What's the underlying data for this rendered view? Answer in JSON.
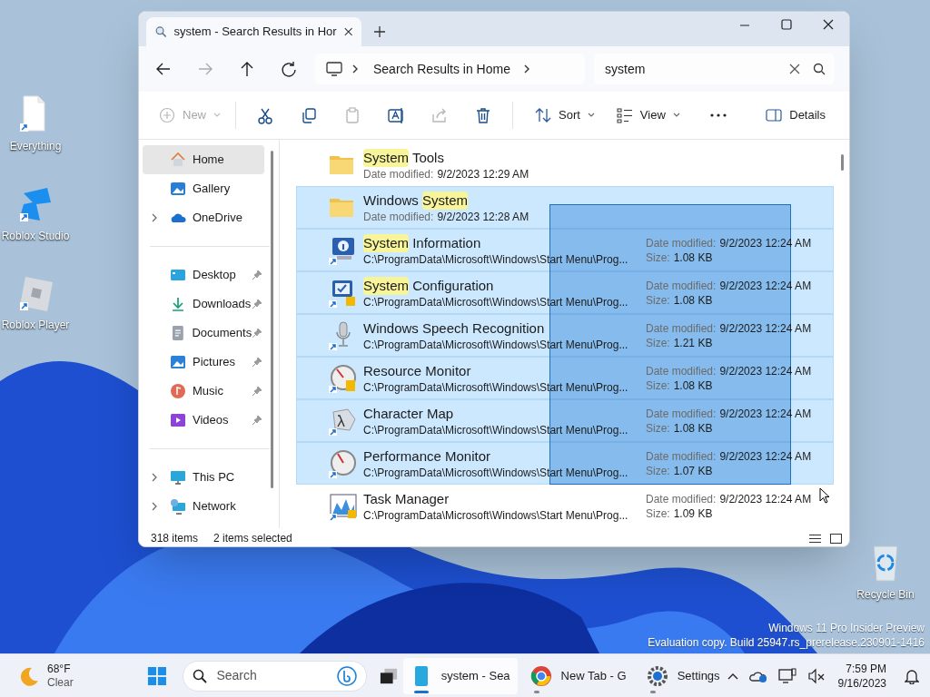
{
  "desktop_icons": [
    {
      "label": "Everything"
    },
    {
      "label": "Roblox Studio"
    },
    {
      "label": "Roblox Player"
    },
    {
      "label": "Recycle Bin"
    }
  ],
  "window": {
    "tab": {
      "title": "system - Search Results in Hor",
      "selected": true
    },
    "address": {
      "location": "Search Results in Home"
    },
    "search": {
      "value": "system"
    },
    "command_bar": [
      {
        "kind": "menu",
        "label": "New",
        "disabled": true
      },
      {
        "kind": "separator"
      },
      {
        "kind": "icon",
        "disabled": false
      },
      {
        "kind": "icon",
        "disabled": false
      },
      {
        "kind": "icon",
        "disabled": true
      },
      {
        "kind": "icon",
        "disabled": false
      },
      {
        "kind": "icon",
        "disabled": true
      },
      {
        "kind": "icon",
        "disabled": false
      },
      {
        "kind": "separator"
      },
      {
        "kind": "menu",
        "label": "Sort",
        "disabled": false
      },
      {
        "kind": "menu",
        "label": "View",
        "disabled": false
      },
      {
        "kind": "more",
        "disabled": false
      },
      {
        "kind": "toggle",
        "label": "Details",
        "disabled": false
      }
    ],
    "sidebar": [
      [
        {
          "label": "Home",
          "selected": true,
          "expandable": false,
          "pinned": false
        },
        {
          "label": "Gallery",
          "selected": false,
          "expandable": false,
          "pinned": false
        },
        {
          "label": "OneDrive",
          "selected": false,
          "expandable": true,
          "pinned": false
        }
      ],
      [
        {
          "label": "Desktop",
          "selected": false,
          "expandable": false,
          "pinned": true
        },
        {
          "label": "Downloads",
          "selected": false,
          "expandable": false,
          "pinned": true
        },
        {
          "label": "Documents",
          "selected": false,
          "expandable": false,
          "pinned": true
        },
        {
          "label": "Pictures",
          "selected": false,
          "expandable": false,
          "pinned": true
        },
        {
          "label": "Music",
          "selected": false,
          "expandable": false,
          "pinned": true
        },
        {
          "label": "Videos",
          "selected": false,
          "expandable": false,
          "pinned": true
        }
      ],
      [
        {
          "label": "This PC",
          "selected": false,
          "expandable": true,
          "pinned": false
        },
        {
          "label": "Network",
          "selected": false,
          "expandable": true,
          "pinned": false
        }
      ]
    ],
    "rows": [
      {
        "kind": "folder",
        "selected": false,
        "name_parts": [
          {
            "text": "System",
            "highlight": true
          },
          {
            "text": " Tools",
            "highlight": false
          }
        ],
        "date_label": "Date modified:",
        "date": "9/2/2023 12:29 AM"
      },
      {
        "kind": "folder",
        "selected": true,
        "name_parts": [
          {
            "text": "Windows ",
            "highlight": false
          },
          {
            "text": "System",
            "highlight": true
          }
        ],
        "date_label": "Date modified:",
        "date": "9/2/2023 12:28 AM"
      },
      {
        "kind": "shortcut",
        "selected": true,
        "name_parts": [
          {
            "text": "System",
            "highlight": true
          },
          {
            "text": " Information",
            "highlight": false
          }
        ],
        "path": "C:\\ProgramData\\Microsoft\\Windows\\Start Menu\\Prog...",
        "date_label": "Date modified:",
        "date": "9/2/2023 12:24 AM",
        "size_label": "Size:",
        "size": "1.08 KB"
      },
      {
        "kind": "shortcut",
        "selected": true,
        "name_parts": [
          {
            "text": "System",
            "highlight": true
          },
          {
            "text": " Configuration",
            "highlight": false
          }
        ],
        "path": "C:\\ProgramData\\Microsoft\\Windows\\Start Menu\\Prog...",
        "date_label": "Date modified:",
        "date": "9/2/2023 12:24 AM",
        "size_label": "Size:",
        "size": "1.08 KB"
      },
      {
        "kind": "shortcut",
        "selected": true,
        "name_parts": [
          {
            "text": "Windows Speech Recognition",
            "highlight": false
          }
        ],
        "path": "C:\\ProgramData\\Microsoft\\Windows\\Start Menu\\Prog...",
        "date_label": "Date modified:",
        "date": "9/2/2023 12:24 AM",
        "size_label": "Size:",
        "size": "1.21 KB"
      },
      {
        "kind": "shortcut",
        "selected": true,
        "name_parts": [
          {
            "text": "Resource Monitor",
            "highlight": false
          }
        ],
        "path": "C:\\ProgramData\\Microsoft\\Windows\\Start Menu\\Prog...",
        "date_label": "Date modified:",
        "date": "9/2/2023 12:24 AM",
        "size_label": "Size:",
        "size": "1.08 KB"
      },
      {
        "kind": "shortcut",
        "selected": true,
        "name_parts": [
          {
            "text": "Character Map",
            "highlight": false
          }
        ],
        "path": "C:\\ProgramData\\Microsoft\\Windows\\Start Menu\\Prog...",
        "date_label": "Date modified:",
        "date": "9/2/2023 12:24 AM",
        "size_label": "Size:",
        "size": "1.08 KB"
      },
      {
        "kind": "shortcut",
        "selected": true,
        "name_parts": [
          {
            "text": "Performance Monitor",
            "highlight": false
          }
        ],
        "path": "C:\\ProgramData\\Microsoft\\Windows\\Start Menu\\Prog...",
        "date_label": "Date modified:",
        "date": "9/2/2023 12:24 AM",
        "size_label": "Size:",
        "size": "1.07 KB"
      },
      {
        "kind": "shortcut",
        "selected": false,
        "name_parts": [
          {
            "text": "Task Manager",
            "highlight": false
          }
        ],
        "path": "C:\\ProgramData\\Microsoft\\Windows\\Start Menu\\Prog...",
        "date_label": "Date modified:",
        "date": "9/2/2023 12:24 AM",
        "size_label": "Size:",
        "size": "1.09 KB"
      }
    ],
    "status_bar": {
      "count": "318 items",
      "selection": "2 items selected"
    }
  },
  "watermark_os": [
    "Windows 11 Pro Insider Preview",
    "Evaluation copy. Build 25947.rs_prerelease.230901-1416"
  ],
  "taskbar": {
    "weather": {
      "temperature": "68°F",
      "condition": "Clear"
    },
    "search": {
      "placeholder": "Search"
    },
    "apps": [
      {
        "label": "system - Sea",
        "active": true
      },
      {
        "label": "New Tab - G",
        "active": false
      },
      {
        "label": "Settings",
        "active": false
      }
    ],
    "clock": {
      "time": "7:59 PM",
      "date": "9/16/2023"
    }
  }
}
